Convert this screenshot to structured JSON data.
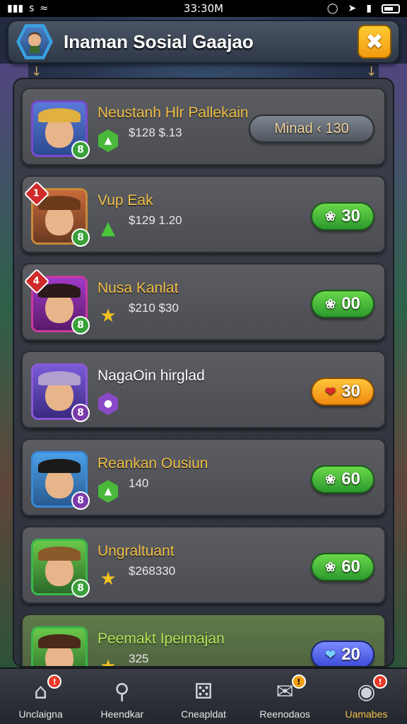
{
  "status_bar": {
    "left_text": "⁙⁙⁙ .⁙⁙⁙ ⁙⁙ ⁙⁙⁙",
    "carrier": "… ⁙l",
    "time": "33:30M"
  },
  "header": {
    "title": "Inaman Sosial Gaajao",
    "close_label": "✖",
    "avatar_icon": "hero-portrait-icon"
  },
  "rows": [
    {
      "name": "Neustanh Hlr Pallekain",
      "sub": "$128 $.13",
      "level": "8",
      "action_label": "Minad ‹ 130",
      "action_style": "gray",
      "rank_icon": "green-shield-icon"
    },
    {
      "name": "Vup Eak",
      "sub": "$129 1.20",
      "level": "8",
      "action_label": "30",
      "action_style": "green",
      "rank_icon": "green-triangle-icon",
      "notif": "1"
    },
    {
      "name": "Nusa Kanlat",
      "sub": "$210 $30",
      "level": "8",
      "action_label": "00",
      "action_style": "green",
      "rank_icon": "star-icon",
      "notif": "4"
    },
    {
      "name": "NagaOin hirglad",
      "sub": "",
      "level": "8",
      "action_label": "30",
      "action_style": "orange",
      "rank_icon": "purple-shield-icon"
    },
    {
      "name": "Reankan Ousiun",
      "sub": "140",
      "level": "8",
      "action_label": "60",
      "action_style": "green",
      "rank_icon": "green-shield-icon"
    },
    {
      "name": "Ungraltuant",
      "sub": "$268330",
      "level": "8",
      "action_label": "60",
      "action_style": "green",
      "rank_icon": "star-icon"
    },
    {
      "name": "Peemakt Ipeimajan",
      "sub": "325",
      "level": "8",
      "action_label": "20",
      "action_style": "blue",
      "rank_icon": "star-icon"
    }
  ],
  "nav": [
    {
      "label": "Unclaigna",
      "icon": "home-icon",
      "badge": "!"
    },
    {
      "label": "Heendkar",
      "icon": "search-icon"
    },
    {
      "label": "Cneapldat",
      "icon": "dice-icon"
    },
    {
      "label": "Reenodaos",
      "icon": "chat-icon",
      "badge": "!"
    },
    {
      "label": "Uamabes",
      "icon": "profile-icon",
      "badge": "!"
    }
  ],
  "colors": {
    "accent_gold": "#f2c14a",
    "pill_green": "#3aa83a",
    "pill_orange": "#f5a020",
    "pill_blue": "#4a5ae8",
    "close_yellow": "#f5b020"
  }
}
